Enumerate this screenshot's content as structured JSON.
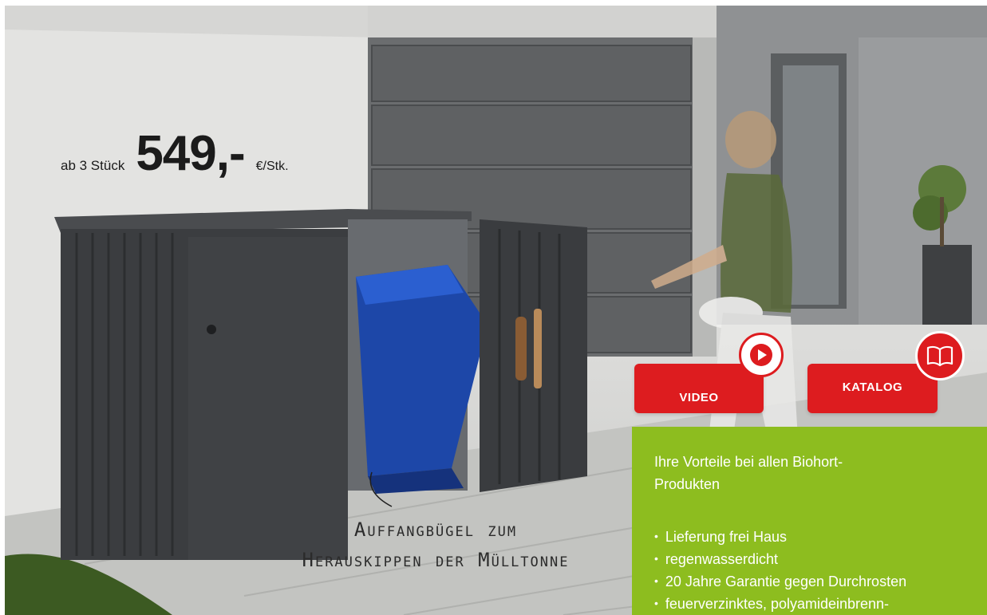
{
  "colors": {
    "accent_red": "#dd1c1f",
    "panel_green": "#8dbd1f",
    "text_dark": "#1b1b1b"
  },
  "price": {
    "prefix": "ab 3 Stück",
    "amount": "549,-",
    "unit": "€/Stk."
  },
  "caption": {
    "line1": "Auffangbügel zum",
    "line2": "Herauskippen der Mülltonne"
  },
  "buttons": {
    "video_label": "VIDEO",
    "katalog_label": "KATALOG",
    "video_icon": "play-icon",
    "katalog_icon": "book-icon"
  },
  "benefits": {
    "heading": "Ihre Vorteile bei allen Biohort-Produkten",
    "items": [
      "Lieferung frei Haus",
      "regenwasserdicht",
      "20 Jahre Garantie gegen Durchrosten",
      "feuerverzinktes, polyamideinbrenn-"
    ]
  }
}
